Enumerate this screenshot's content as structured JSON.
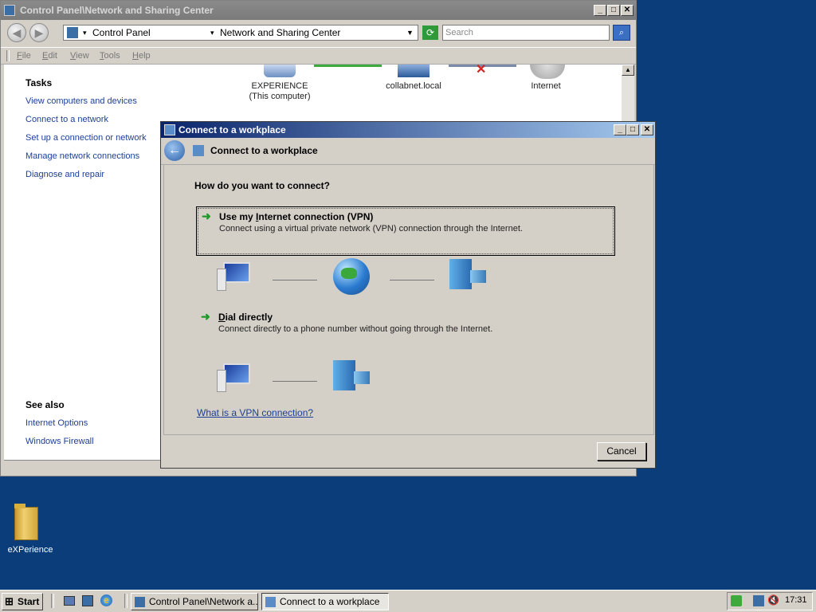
{
  "cp_window": {
    "title": "Control Panel\\Network and Sharing Center",
    "breadcrumb": [
      "Control Panel",
      "Network and Sharing Center"
    ],
    "search_placeholder": "Search",
    "menu": [
      {
        "key": "F",
        "rest": "ile"
      },
      {
        "key": "E",
        "rest": "dit"
      },
      {
        "key": "V",
        "rest": "iew"
      },
      {
        "key": "T",
        "rest": "ools"
      },
      {
        "key": "H",
        "rest": "elp"
      }
    ],
    "tasks_heading": "Tasks",
    "tasks": [
      "View computers and devices",
      "Connect to a network",
      "Set up a connection or network",
      "Manage network connections",
      "Diagnose and repair"
    ],
    "see_also_heading": "See also",
    "see_also": [
      "Internet Options",
      "Windows Firewall"
    ],
    "map": {
      "computer_name": "EXPERIENCE",
      "computer_sub": "(This computer)",
      "network_name": "collabnet.local",
      "internet_label": "Internet"
    }
  },
  "dialog": {
    "title": "Connect to a workplace",
    "header": "Connect to a workplace",
    "question": "How do you want to connect?",
    "options": [
      {
        "title_pre": "Use my ",
        "title_key": "I",
        "title_post": "nternet connection (VPN)",
        "desc": "Connect using a virtual private network (VPN) connection through the Internet."
      },
      {
        "title_pre": "",
        "title_key": "D",
        "title_post": "ial directly",
        "desc": "Connect directly to a phone number without going through the Internet."
      }
    ],
    "help_link": "What is a VPN connection?",
    "cancel_label": "Cancel"
  },
  "desktop": {
    "icon_label": "eXPerience"
  },
  "taskbar": {
    "start_label": "Start",
    "tasks": [
      "Control Panel\\Network a...",
      "Connect to a workplace"
    ],
    "clock": "17:31"
  }
}
